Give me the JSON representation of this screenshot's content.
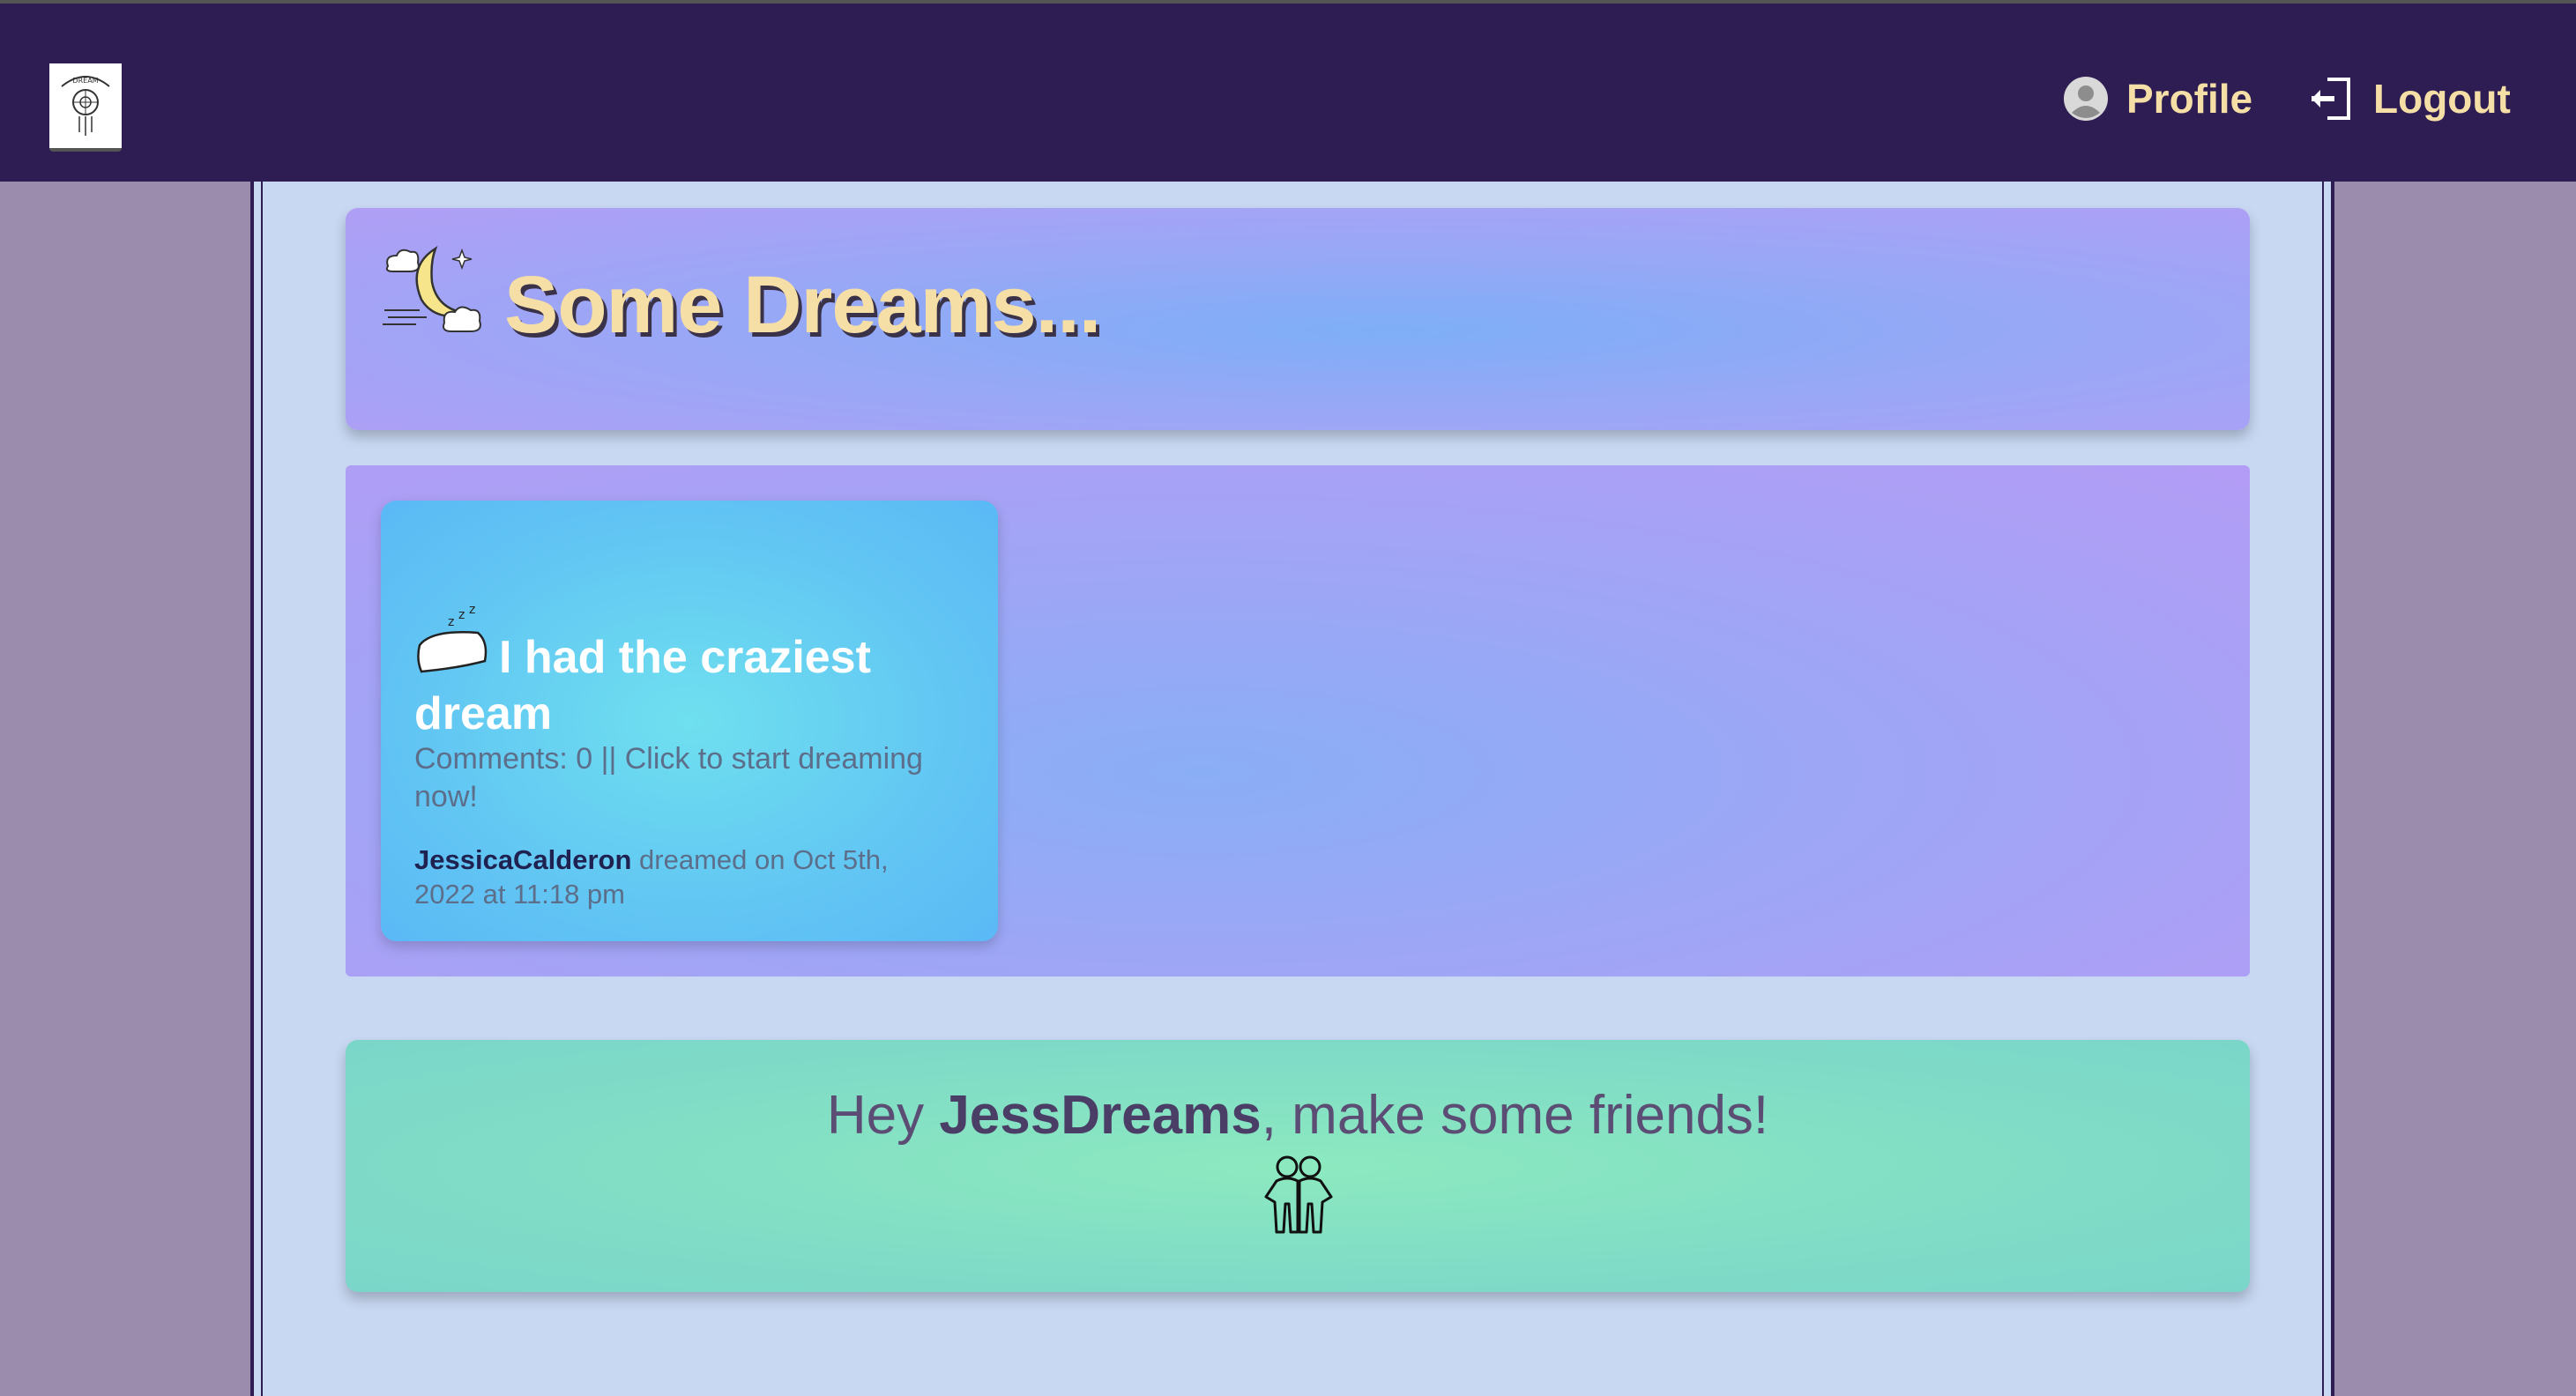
{
  "nav": {
    "logo_icon": "dream-catcher-logo-icon",
    "profile_label": "Profile",
    "logout_label": "Logout",
    "profile_icon": "user-circle-icon",
    "logout_icon": "logout-door-icon"
  },
  "header": {
    "title": "Some Dreams...",
    "icon": "moon-clouds-icon"
  },
  "dreams": [
    {
      "title": "I had the craziest dream",
      "meta": "Comments: 0 || Click to start dreaming now!",
      "author": "JessicaCalderon",
      "dreamed_on": " dreamed on Oct 5th, 2022 at 11:18 pm",
      "icon": "sleeping-pillow-icon"
    }
  ],
  "friends": {
    "prefix": "Hey ",
    "username": "JessDreams",
    "suffix": ", make some friends!",
    "icon": "two-people-icon"
  },
  "colors": {
    "navbar": "#2d1d52",
    "accent_gold": "#f6dfa6",
    "page_bg": "#c8d8f2",
    "side_bg": "#9b8bad"
  }
}
